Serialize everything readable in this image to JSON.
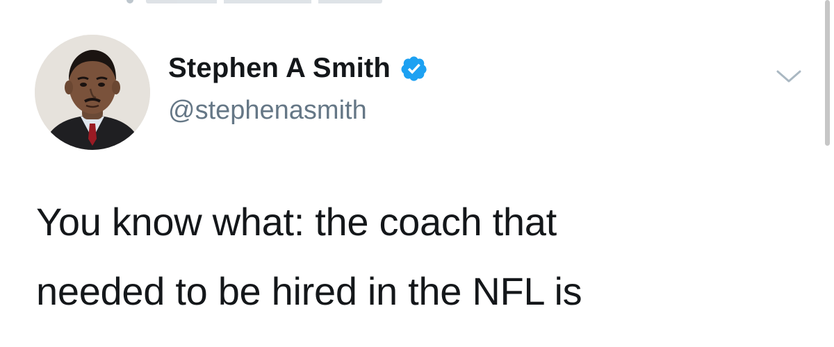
{
  "tweet": {
    "author": {
      "display_name": "Stephen A Smith",
      "handle": "@stephenasmith",
      "verified": true,
      "avatar_icon": "profile-photo"
    },
    "text_lines": [
      "You know what: the coach that",
      "needed to be hired in the NFL is"
    ],
    "menu_icon": "chevron-down-icon"
  },
  "colors": {
    "name": "#14171a",
    "handle": "#657786",
    "verified_badge": "#1da1f2",
    "caret": "#aab8c2",
    "background": "#ffffff"
  }
}
